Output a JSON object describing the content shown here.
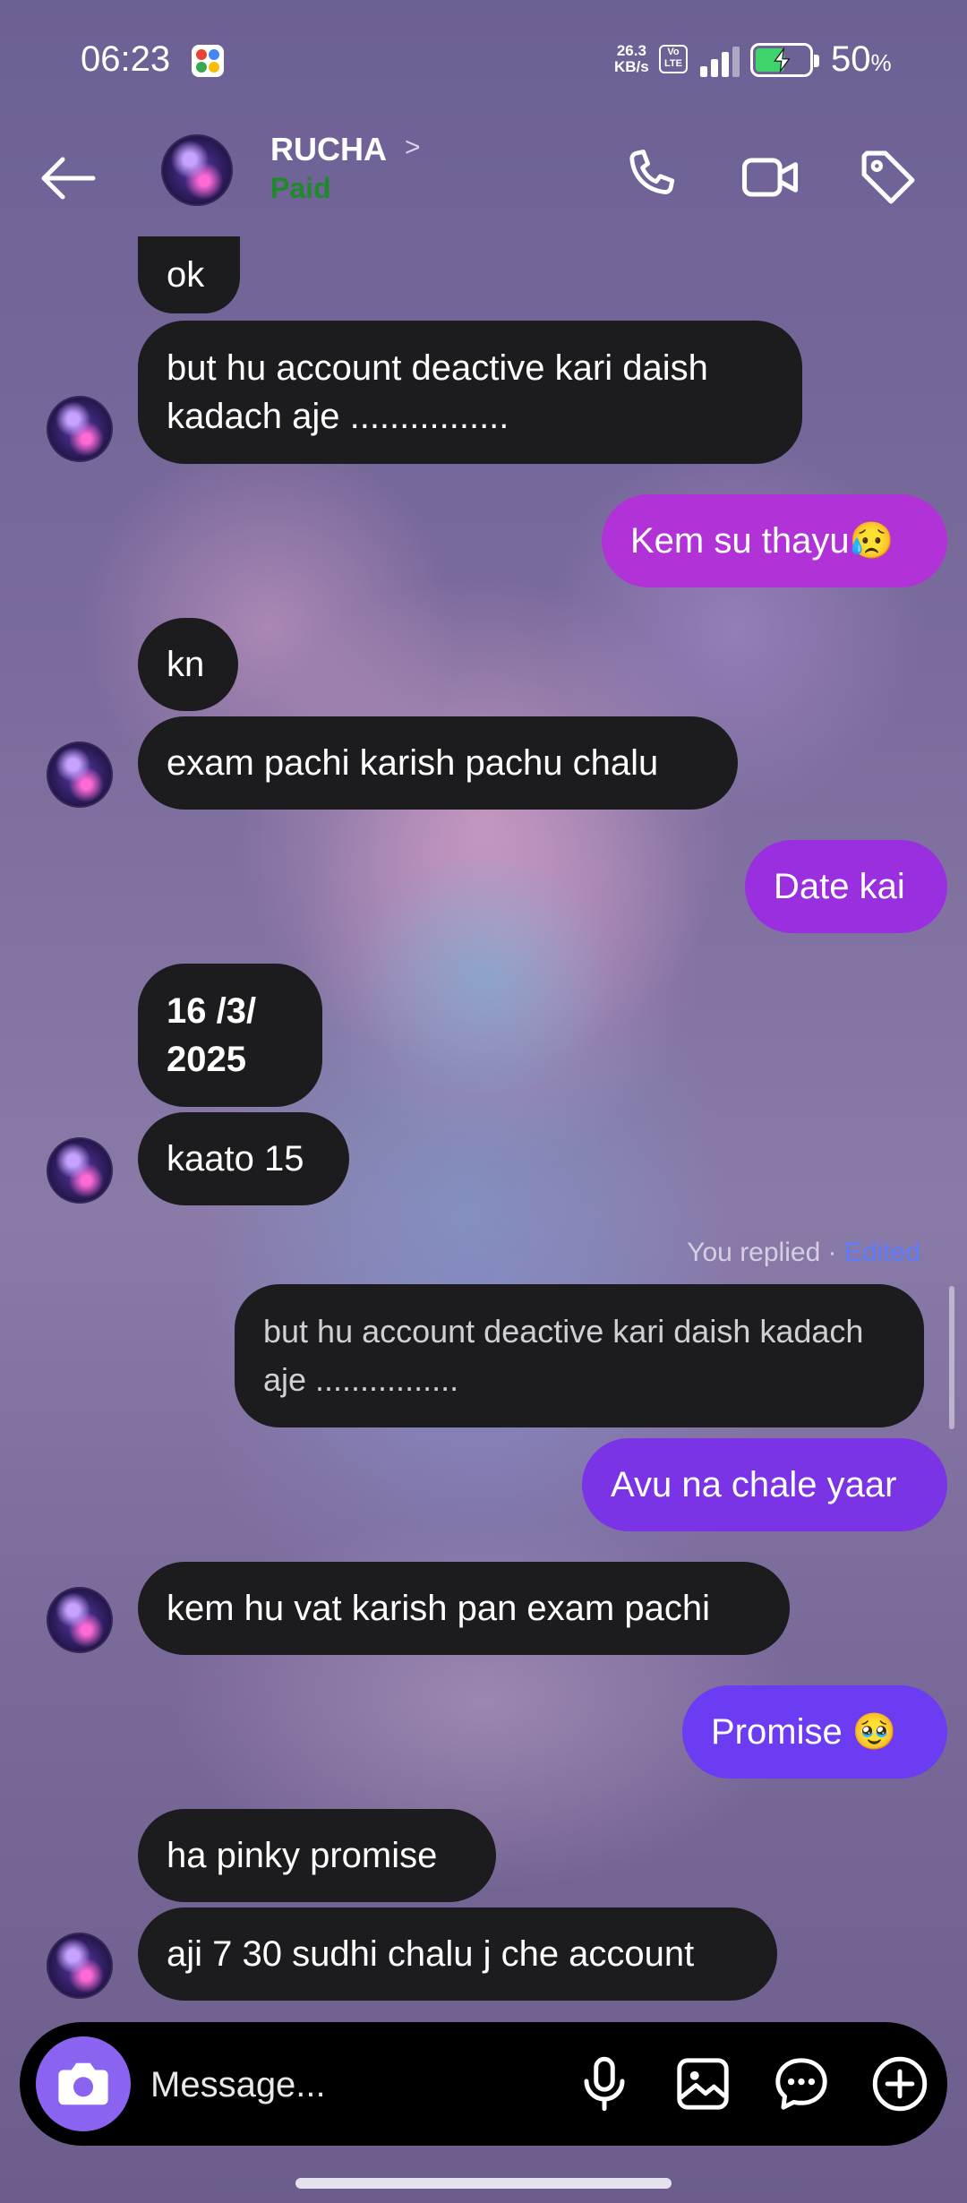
{
  "status_bar": {
    "time": "06:23",
    "net_speed_value": "26.3",
    "net_speed_unit": "KB/s",
    "volte": "Vo LTE",
    "battery_value": "50",
    "battery_unit": "%"
  },
  "header": {
    "contact_name": "RUCHA",
    "chevron": ">",
    "subtitle": "Paid",
    "icons": [
      "back-arrow-icon",
      "phone-icon",
      "video-icon",
      "tag-icon"
    ]
  },
  "messages": [
    {
      "dir": "in",
      "text": "ok"
    },
    {
      "dir": "in",
      "text": "but hu account deactive kari daish kadach aje ................"
    },
    {
      "dir": "out",
      "text": "Kem su thayu😥"
    },
    {
      "dir": "in",
      "text": "kn"
    },
    {
      "dir": "in",
      "text": "exam pachi karish pachu chalu"
    },
    {
      "dir": "out",
      "text": "Date kai"
    },
    {
      "dir": "in",
      "text": "16 /3/ 2025"
    },
    {
      "dir": "in",
      "text": "kaato 15"
    },
    {
      "dir": "in",
      "text": "kem hu vat karish pan exam pachi"
    },
    {
      "dir": "out",
      "text": "Avu na chale yaar"
    },
    {
      "dir": "out",
      "text": "Promise 🥹"
    },
    {
      "dir": "in",
      "text": "ha pinky promise"
    },
    {
      "dir": "in",
      "text": "aji 7 30 sudhi chalu j che account"
    }
  ],
  "reply": {
    "label": "You replied · ",
    "edited": "Edited",
    "quoted_text": "but hu account deactive kari daish kadach aje ................"
  },
  "composer": {
    "placeholder": "Message...",
    "icons": [
      "camera-icon",
      "microphone-icon",
      "gallery-icon",
      "sticker-chat-icon",
      "plus-icon"
    ]
  },
  "colors": {
    "incoming_bubble": "#1c1c1e",
    "outgoing_magenta": "#b133d8",
    "outgoing_purple": "#7a34e6",
    "outgoing_blue": "#6b3cf2",
    "paid_green": "#1f8a2a",
    "camera_button": "#8a64f0"
  }
}
